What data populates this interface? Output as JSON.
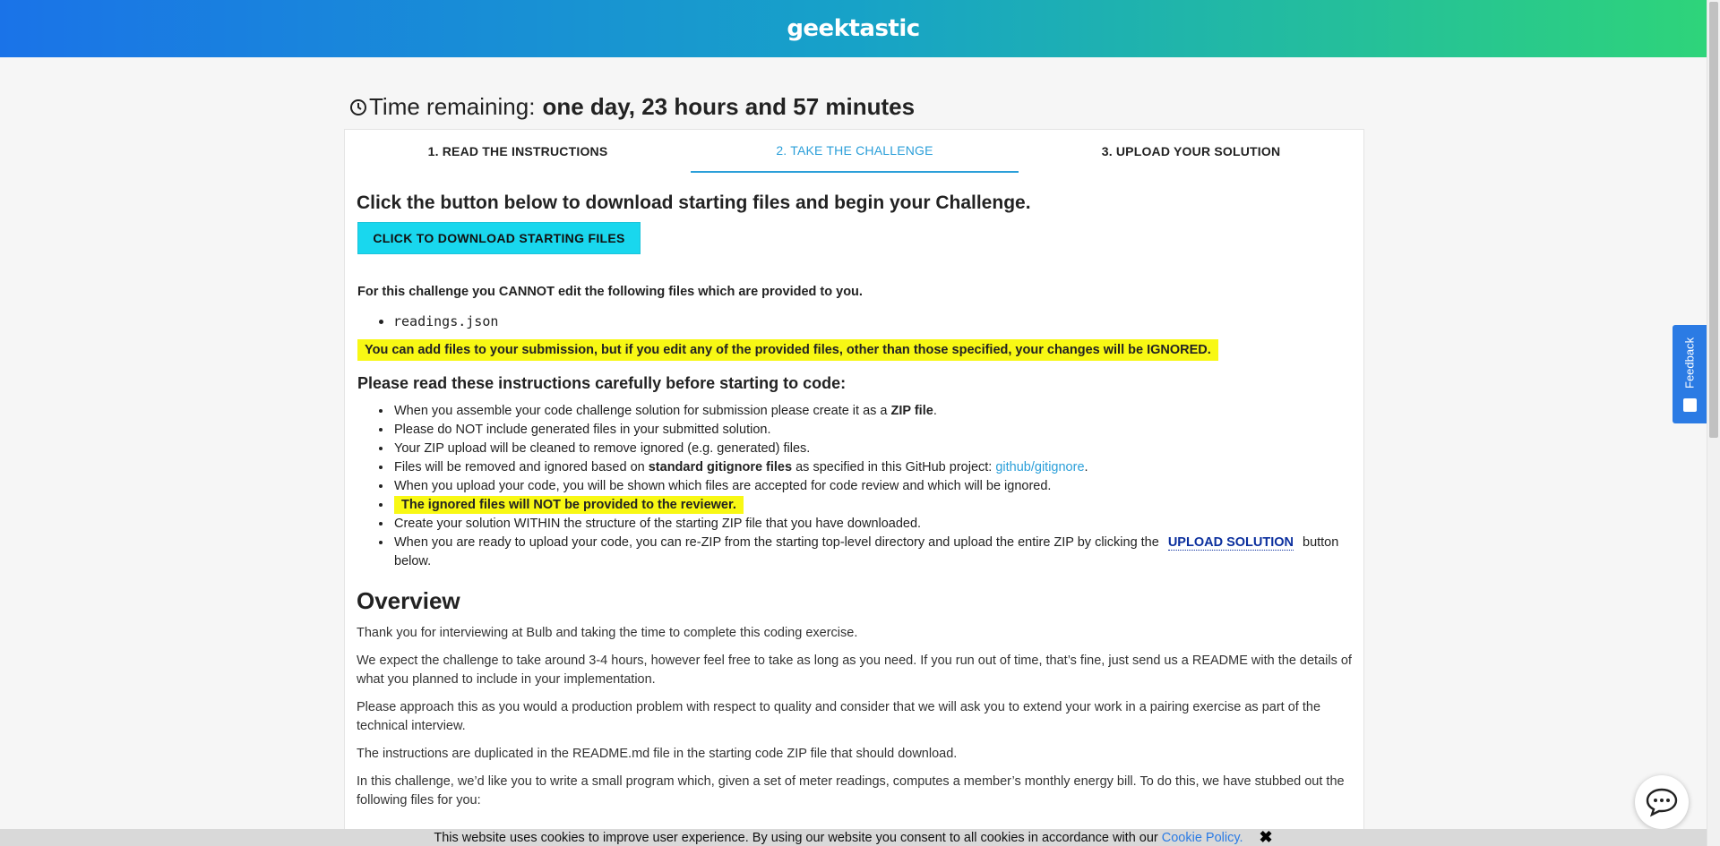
{
  "header": {
    "logo": "geektastic"
  },
  "timer": {
    "label": "Time remaining:",
    "value": "one day, 23 hours and 57 minutes"
  },
  "tabs": [
    {
      "label": "1. READ THE INSTRUCTIONS"
    },
    {
      "label": "2. TAKE THE CHALLENGE"
    },
    {
      "label": "3. UPLOAD YOUR SOLUTION"
    }
  ],
  "challenge": {
    "lead": "Click the button below to download starting files and begin your Challenge.",
    "download_button": "CLICK TO DOWNLOAD STARTING FILES",
    "cannot_edit_note": "For this challenge you CANNOT edit the following files which are provided to you.",
    "files": [
      "readings.json"
    ],
    "warning": "You can add files to your submission, but if you edit any of the provided files, other than those specified, your changes will be IGNORED.",
    "instructions_heading": "Please read these instructions carefully before starting to code:",
    "rules": {
      "r1_a": "When you assemble your code challenge solution for submission please create it as a ",
      "r1_b": "ZIP file",
      "r1_c": ".",
      "r2": "Please do NOT include generated files in your submitted solution.",
      "r3": "Your ZIP upload will be cleaned to remove ignored (e.g. generated) files.",
      "r4_a": "Files will be removed and ignored based on ",
      "r4_b": "standard gitignore files",
      "r4_c": " as specified in this GitHub project: ",
      "r4_link": "github/gitignore",
      "r4_d": ".",
      "r5": "When you upload your code, you will be shown which files are accepted for code review and which will be ignored.",
      "r6": "The ignored files will NOT be provided to the reviewer.",
      "r7": "Create your solution WITHIN the structure of the starting ZIP file that you have downloaded.",
      "r8_a": "When you are ready to upload your code, you can re-ZIP from the starting top-level directory and upload the entire ZIP by clicking the",
      "r8_link": "UPLOAD SOLUTION",
      "r8_b": "button below."
    }
  },
  "overview": {
    "heading": "Overview",
    "paragraphs": [
      "Thank you for interviewing at Bulb and taking the time to complete this coding exercise.",
      "We expect the challenge to take around 3-4 hours, however feel free to take as long as you need. If you run out of time, that’s fine, just send us a README with the details of what you planned to include in your implementation.",
      "Please approach this as you would a production problem with respect to quality and consider that we will ask you to extend your work in a pairing exercise as part of the technical interview.",
      "The instructions are duplicated in the README.md file in the starting code ZIP file that should download.",
      "In this challenge, we’d like you to write a small program which, given a set of meter readings, computes a member’s monthly energy bill. To do this, we have stubbed out the following files for you:"
    ]
  },
  "feedback": {
    "label": "Feedback"
  },
  "cookie": {
    "text": "This website uses cookies to improve user experience. By using our website you consent to all cookies in accordance with our",
    "link": "Cookie Policy.",
    "close": "✖"
  },
  "colors": {
    "accent": "#2b9fd9",
    "button": "#19d7ee",
    "highlight": "#f8f814"
  }
}
